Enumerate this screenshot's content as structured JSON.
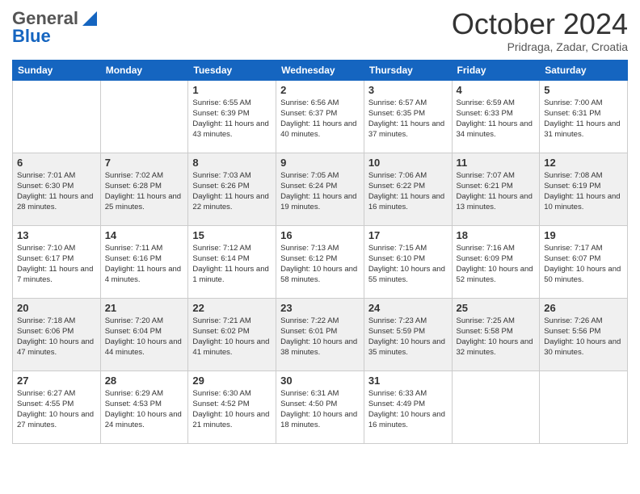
{
  "header": {
    "logo_general": "General",
    "logo_blue": "Blue",
    "month_title": "October 2024",
    "location": "Pridraga, Zadar, Croatia"
  },
  "weekdays": [
    "Sunday",
    "Monday",
    "Tuesday",
    "Wednesday",
    "Thursday",
    "Friday",
    "Saturday"
  ],
  "weeks": [
    [
      {
        "day": "",
        "sunrise": "",
        "sunset": "",
        "daylight": ""
      },
      {
        "day": "",
        "sunrise": "",
        "sunset": "",
        "daylight": ""
      },
      {
        "day": "1",
        "sunrise": "Sunrise: 6:55 AM",
        "sunset": "Sunset: 6:39 PM",
        "daylight": "Daylight: 11 hours and 43 minutes."
      },
      {
        "day": "2",
        "sunrise": "Sunrise: 6:56 AM",
        "sunset": "Sunset: 6:37 PM",
        "daylight": "Daylight: 11 hours and 40 minutes."
      },
      {
        "day": "3",
        "sunrise": "Sunrise: 6:57 AM",
        "sunset": "Sunset: 6:35 PM",
        "daylight": "Daylight: 11 hours and 37 minutes."
      },
      {
        "day": "4",
        "sunrise": "Sunrise: 6:59 AM",
        "sunset": "Sunset: 6:33 PM",
        "daylight": "Daylight: 11 hours and 34 minutes."
      },
      {
        "day": "5",
        "sunrise": "Sunrise: 7:00 AM",
        "sunset": "Sunset: 6:31 PM",
        "daylight": "Daylight: 11 hours and 31 minutes."
      }
    ],
    [
      {
        "day": "6",
        "sunrise": "Sunrise: 7:01 AM",
        "sunset": "Sunset: 6:30 PM",
        "daylight": "Daylight: 11 hours and 28 minutes."
      },
      {
        "day": "7",
        "sunrise": "Sunrise: 7:02 AM",
        "sunset": "Sunset: 6:28 PM",
        "daylight": "Daylight: 11 hours and 25 minutes."
      },
      {
        "day": "8",
        "sunrise": "Sunrise: 7:03 AM",
        "sunset": "Sunset: 6:26 PM",
        "daylight": "Daylight: 11 hours and 22 minutes."
      },
      {
        "day": "9",
        "sunrise": "Sunrise: 7:05 AM",
        "sunset": "Sunset: 6:24 PM",
        "daylight": "Daylight: 11 hours and 19 minutes."
      },
      {
        "day": "10",
        "sunrise": "Sunrise: 7:06 AM",
        "sunset": "Sunset: 6:22 PM",
        "daylight": "Daylight: 11 hours and 16 minutes."
      },
      {
        "day": "11",
        "sunrise": "Sunrise: 7:07 AM",
        "sunset": "Sunset: 6:21 PM",
        "daylight": "Daylight: 11 hours and 13 minutes."
      },
      {
        "day": "12",
        "sunrise": "Sunrise: 7:08 AM",
        "sunset": "Sunset: 6:19 PM",
        "daylight": "Daylight: 11 hours and 10 minutes."
      }
    ],
    [
      {
        "day": "13",
        "sunrise": "Sunrise: 7:10 AM",
        "sunset": "Sunset: 6:17 PM",
        "daylight": "Daylight: 11 hours and 7 minutes."
      },
      {
        "day": "14",
        "sunrise": "Sunrise: 7:11 AM",
        "sunset": "Sunset: 6:16 PM",
        "daylight": "Daylight: 11 hours and 4 minutes."
      },
      {
        "day": "15",
        "sunrise": "Sunrise: 7:12 AM",
        "sunset": "Sunset: 6:14 PM",
        "daylight": "Daylight: 11 hours and 1 minute."
      },
      {
        "day": "16",
        "sunrise": "Sunrise: 7:13 AM",
        "sunset": "Sunset: 6:12 PM",
        "daylight": "Daylight: 10 hours and 58 minutes."
      },
      {
        "day": "17",
        "sunrise": "Sunrise: 7:15 AM",
        "sunset": "Sunset: 6:10 PM",
        "daylight": "Daylight: 10 hours and 55 minutes."
      },
      {
        "day": "18",
        "sunrise": "Sunrise: 7:16 AM",
        "sunset": "Sunset: 6:09 PM",
        "daylight": "Daylight: 10 hours and 52 minutes."
      },
      {
        "day": "19",
        "sunrise": "Sunrise: 7:17 AM",
        "sunset": "Sunset: 6:07 PM",
        "daylight": "Daylight: 10 hours and 50 minutes."
      }
    ],
    [
      {
        "day": "20",
        "sunrise": "Sunrise: 7:18 AM",
        "sunset": "Sunset: 6:06 PM",
        "daylight": "Daylight: 10 hours and 47 minutes."
      },
      {
        "day": "21",
        "sunrise": "Sunrise: 7:20 AM",
        "sunset": "Sunset: 6:04 PM",
        "daylight": "Daylight: 10 hours and 44 minutes."
      },
      {
        "day": "22",
        "sunrise": "Sunrise: 7:21 AM",
        "sunset": "Sunset: 6:02 PM",
        "daylight": "Daylight: 10 hours and 41 minutes."
      },
      {
        "day": "23",
        "sunrise": "Sunrise: 7:22 AM",
        "sunset": "Sunset: 6:01 PM",
        "daylight": "Daylight: 10 hours and 38 minutes."
      },
      {
        "day": "24",
        "sunrise": "Sunrise: 7:23 AM",
        "sunset": "Sunset: 5:59 PM",
        "daylight": "Daylight: 10 hours and 35 minutes."
      },
      {
        "day": "25",
        "sunrise": "Sunrise: 7:25 AM",
        "sunset": "Sunset: 5:58 PM",
        "daylight": "Daylight: 10 hours and 32 minutes."
      },
      {
        "day": "26",
        "sunrise": "Sunrise: 7:26 AM",
        "sunset": "Sunset: 5:56 PM",
        "daylight": "Daylight: 10 hours and 30 minutes."
      }
    ],
    [
      {
        "day": "27",
        "sunrise": "Sunrise: 6:27 AM",
        "sunset": "Sunset: 4:55 PM",
        "daylight": "Daylight: 10 hours and 27 minutes."
      },
      {
        "day": "28",
        "sunrise": "Sunrise: 6:29 AM",
        "sunset": "Sunset: 4:53 PM",
        "daylight": "Daylight: 10 hours and 24 minutes."
      },
      {
        "day": "29",
        "sunrise": "Sunrise: 6:30 AM",
        "sunset": "Sunset: 4:52 PM",
        "daylight": "Daylight: 10 hours and 21 minutes."
      },
      {
        "day": "30",
        "sunrise": "Sunrise: 6:31 AM",
        "sunset": "Sunset: 4:50 PM",
        "daylight": "Daylight: 10 hours and 18 minutes."
      },
      {
        "day": "31",
        "sunrise": "Sunrise: 6:33 AM",
        "sunset": "Sunset: 4:49 PM",
        "daylight": "Daylight: 10 hours and 16 minutes."
      },
      {
        "day": "",
        "sunrise": "",
        "sunset": "",
        "daylight": ""
      },
      {
        "day": "",
        "sunrise": "",
        "sunset": "",
        "daylight": ""
      }
    ]
  ]
}
